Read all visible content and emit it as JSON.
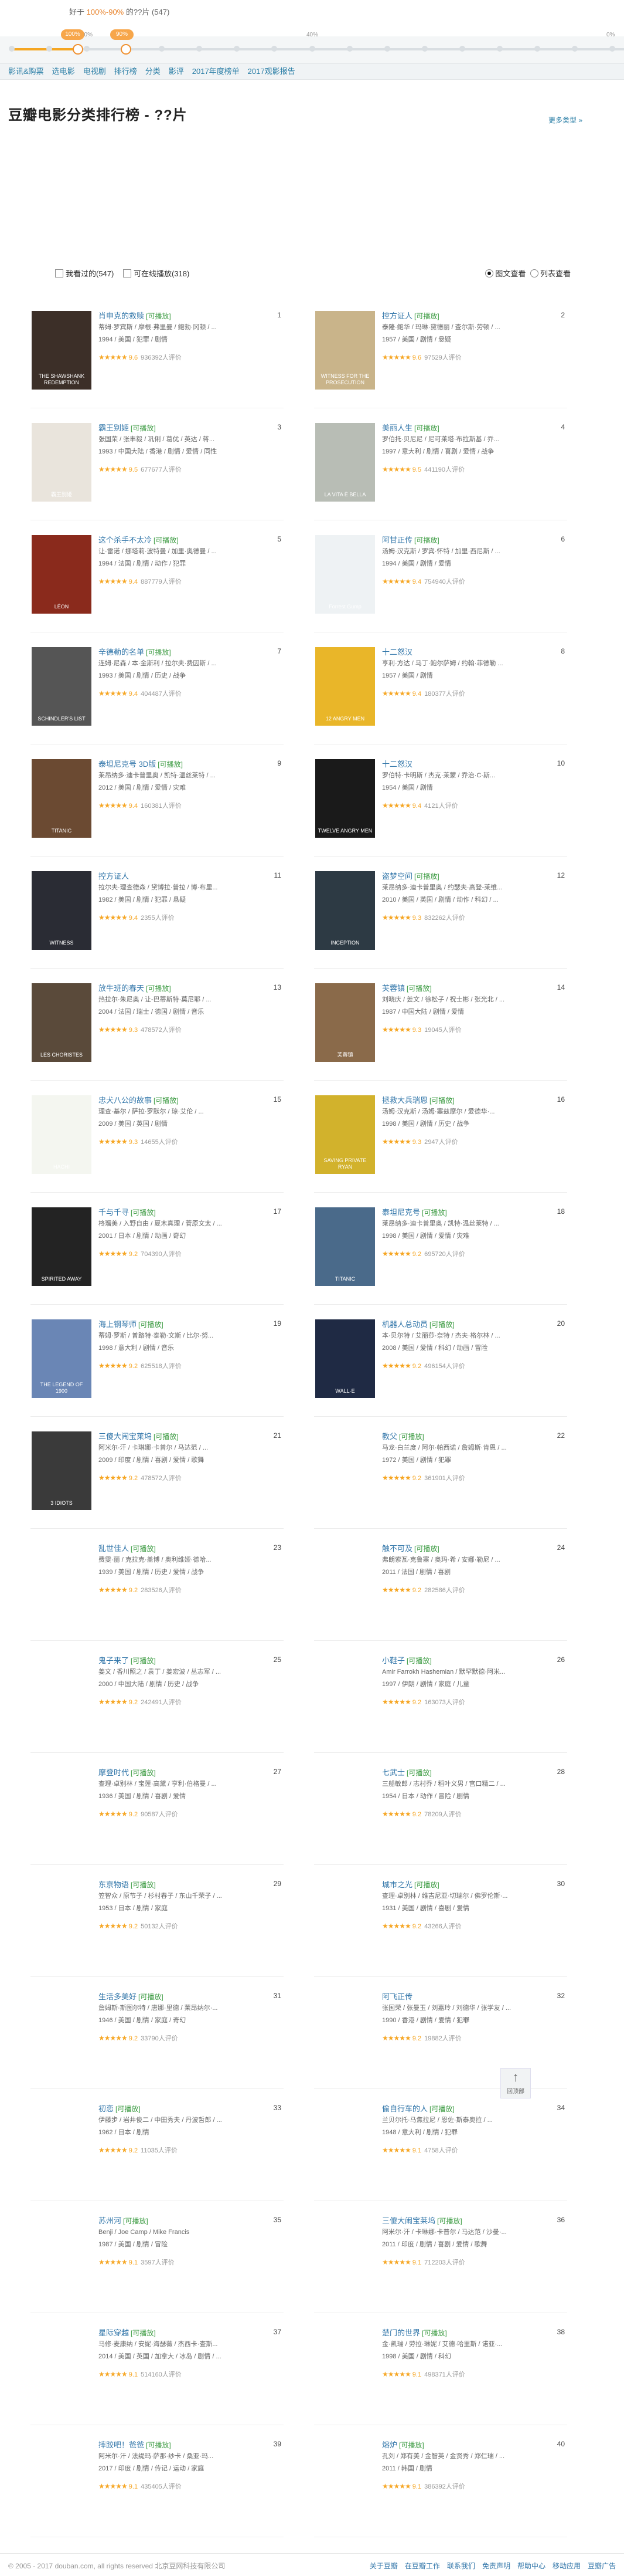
{
  "range": {
    "prefix": "好于",
    "value": "100%-90%",
    "suffix": "的??片 (547)",
    "handle_left": "100%",
    "handle_right": "90%",
    "ticks": [
      {
        "label": "",
        "pos": 0
      },
      {
        "label": "",
        "pos": 0
      },
      {
        "label": "80%",
        "pos": 0
      },
      {
        "label": "",
        "pos": 0
      },
      {
        "label": "",
        "pos": 0
      },
      {
        "label": "",
        "pos": 0
      },
      {
        "label": "",
        "pos": 0
      },
      {
        "label": "",
        "pos": 0
      },
      {
        "label": "40%",
        "pos": 0
      },
      {
        "label": "",
        "pos": 0
      },
      {
        "label": "",
        "pos": 0
      },
      {
        "label": "",
        "pos": 0
      },
      {
        "label": "",
        "pos": 0
      },
      {
        "label": "",
        "pos": 0
      },
      {
        "label": "",
        "pos": 0
      },
      {
        "label": "",
        "pos": 0
      },
      {
        "label": "0%",
        "pos": 0
      }
    ]
  },
  "nav": {
    "items": [
      "影讯&购票",
      "选电影",
      "电视剧",
      "排行榜",
      "分类",
      "影评",
      "2017年度榜单",
      "2017观影报告"
    ]
  },
  "page": {
    "title": "豆瓣电影分类排行榜 - ??片",
    "more": "更多类型 »"
  },
  "filters": {
    "seen": "我看过的(547)",
    "playable": "可在线播放(318)",
    "view_grid": "图文查看",
    "view_list": "列表查看"
  },
  "accent": "#f6a623",
  "movies": [
    {
      "rank": "1",
      "title": "肖申克的救赎",
      "tag": "[可播放]",
      "cast": "蒂姆·罗宾斯 / 摩根·弗里曼 / 鲍勃·冈顿 / ...",
      "meta": "1994 / 美国 / 犯罪 / 剧情",
      "stars": "★★★★★",
      "score": "9.6",
      "votes": "936392人评价",
      "poster": "#3c2f28",
      "ptext": "THE SHAWSHANK REDEMPTION"
    },
    {
      "rank": "2",
      "title": "控方证人",
      "tag": "[可播放]",
      "cast": "泰隆·鲍华 / 玛琳·黛德丽 / 查尔斯·劳顿 / ...",
      "meta": "1957 / 美国 / 剧情 / 悬疑",
      "stars": "★★★★★",
      "score": "9.6",
      "votes": "97529人评价",
      "poster": "#c9b48a",
      "ptext": "WITNESS FOR THE PROSECUTION"
    },
    {
      "rank": "3",
      "title": "霸王别姬",
      "tag": "[可播放]",
      "cast": "张国荣 / 张丰毅 / 巩俐 / 葛优 / 英达 / 蒋...",
      "meta": "1993 / 中国大陆 / 香港 / 剧情 / 爱情 / 同性",
      "stars": "★★★★★",
      "score": "9.5",
      "votes": "677677人评价",
      "poster": "#e9e4dc",
      "ptext": "霸王别姬"
    },
    {
      "rank": "4",
      "title": "美丽人生",
      "tag": "[可播放]",
      "cast": "罗伯托·贝尼尼 / 尼可莱塔·布拉斯基 / 乔...",
      "meta": "1997 / 意大利 / 剧情 / 喜剧 / 爱情 / 战争",
      "stars": "★★★★★",
      "score": "9.5",
      "votes": "441190人评价",
      "poster": "#b8bdb5",
      "ptext": "LA VITA È BELLA"
    },
    {
      "rank": "5",
      "title": "这个杀手不太冷",
      "tag": "[可播放]",
      "cast": "让·雷诺 / 娜塔莉·波特曼 / 加里·奥德曼 / ...",
      "meta": "1994 / 法国 / 剧情 / 动作 / 犯罪",
      "stars": "★★★★★",
      "score": "9.4",
      "votes": "887779人评价",
      "poster": "#8a2a1c",
      "ptext": "LÉON"
    },
    {
      "rank": "6",
      "title": "阿甘正传",
      "tag": "[可播放]",
      "cast": "汤姆·汉克斯 / 罗宾·怀特 / 加里·西尼斯 / ...",
      "meta": "1994 / 美国 / 剧情 / 爱情",
      "stars": "★★★★★",
      "score": "9.4",
      "votes": "754940人评价",
      "poster": "#eef2f4",
      "ptext": "Forrest Gump"
    },
    {
      "rank": "7",
      "title": "辛德勒的名单",
      "tag": "[可播放]",
      "cast": "连姆·尼森 / 本·金斯利 / 拉尔夫·费因斯 / ...",
      "meta": "1993 / 美国 / 剧情 / 历史 / 战争",
      "stars": "★★★★★",
      "score": "9.4",
      "votes": "404487人评价",
      "poster": "#555555",
      "ptext": "SCHINDLER'S LIST"
    },
    {
      "rank": "8",
      "title": "十二怒汉",
      "tag": "",
      "cast": "亨利·方达 / 马丁·鲍尔萨姆 / 约翰·菲德勒 ...",
      "meta": "1957 / 美国 / 剧情",
      "stars": "★★★★★",
      "score": "9.4",
      "votes": "180377人评价",
      "poster": "#e9b629",
      "ptext": "12 ANGRY MEN"
    },
    {
      "rank": "9",
      "title": "泰坦尼克号 3D版",
      "tag": "[可播放]",
      "cast": "莱昂纳多·迪卡普里奥 / 凯特·温丝莱特 / ...",
      "meta": "2012 / 美国 / 剧情 / 爱情 / 灾难",
      "stars": "★★★★★",
      "score": "9.4",
      "votes": "160381人评价",
      "poster": "#6b4a32",
      "ptext": "TITANIC"
    },
    {
      "rank": "10",
      "title": "十二怒汉",
      "tag": "",
      "cast": "罗伯特·卡明斯 / 杰克·莱蒙 / 乔治·C·斯...",
      "meta": "1954 / 美国 / 剧情",
      "stars": "★★★★★",
      "score": "9.4",
      "votes": "4121人评价",
      "poster": "#1a1a1a",
      "ptext": "TWELVE ANGRY MEN"
    },
    {
      "rank": "11",
      "title": "控方证人",
      "tag": "",
      "cast": "拉尔夫·理查德森 / 黛博拉·普拉 / 博·布里...",
      "meta": "1982 / 美国 / 剧情 / 犯罪 / 悬疑",
      "stars": "★★★★★",
      "score": "9.4",
      "votes": "2355人评价",
      "poster": "#2a2c34",
      "ptext": "WITNESS"
    },
    {
      "rank": "12",
      "title": "盗梦空间",
      "tag": "[可播放]",
      "cast": "莱昂纳多·迪卡普里奥 / 约瑟夫·高登-莱维...",
      "meta": "2010 / 美国 / 英国 / 剧情 / 动作 / 科幻 / ...",
      "stars": "★★★★★",
      "score": "9.3",
      "votes": "832262人评价",
      "poster": "#2d3a44",
      "ptext": "INCEPTION"
    },
    {
      "rank": "13",
      "title": "放牛班的春天",
      "tag": "[可播放]",
      "cast": "热拉尔·朱尼奥 / 让-巴蒂斯特·莫尼耶 / ...",
      "meta": "2004 / 法国 / 瑞士 / 德国 / 剧情 / 音乐",
      "stars": "★★★★★",
      "score": "9.3",
      "votes": "478572人评价",
      "poster": "#5a4a3a",
      "ptext": "LES CHORISTES"
    },
    {
      "rank": "14",
      "title": "芙蓉镇",
      "tag": "[可播放]",
      "cast": "刘晓庆 / 姜文 / 徐松子 / 祝士彬 / 张光北 / ...",
      "meta": "1987 / 中国大陆 / 剧情 / 爱情",
      "stars": "★★★★★",
      "score": "9.3",
      "votes": "19045人评价",
      "poster": "#8a6a4a",
      "ptext": "芙蓉镇"
    },
    {
      "rank": "15",
      "title": "忠犬八公的故事",
      "tag": "[可播放]",
      "cast": "理查·基尔 / 萨拉·罗默尔 / 琼·艾伦 / ...",
      "meta": "2009 / 美国 / 英国 / 剧情",
      "stars": "★★★★★",
      "score": "9.3",
      "votes": "14655人评价",
      "poster": "#f4f6f0",
      "ptext": "HACHI"
    },
    {
      "rank": "16",
      "title": "拯救大兵瑞恩",
      "tag": "[可播放]",
      "cast": "汤姆·汉克斯 / 汤姆·塞兹摩尔 / 爱德华·...",
      "meta": "1998 / 美国 / 剧情 / 历史 / 战争",
      "stars": "★★★★★",
      "score": "9.3",
      "votes": "2947人评价",
      "poster": "#d2b22c",
      "ptext": "SAVING PRIVATE RYAN"
    },
    {
      "rank": "17",
      "title": "千与千寻",
      "tag": "[可播放]",
      "cast": "柊瑠美 / 入野自由 / 夏木真理 / 菅原文太 / ...",
      "meta": "2001 / 日本 / 剧情 / 动画 / 奇幻",
      "stars": "★★★★★",
      "score": "9.2",
      "votes": "704390人评价",
      "poster": "#232323",
      "ptext": "SPIRITED AWAY"
    },
    {
      "rank": "18",
      "title": "泰坦尼克号",
      "tag": "[可播放]",
      "cast": "莱昂纳多·迪卡普里奥 / 凯特·温丝莱特 / ...",
      "meta": "1998 / 美国 / 剧情 / 爱情 / 灾难",
      "stars": "★★★★★",
      "score": "9.2",
      "votes": "695720人评价",
      "poster": "#4a6a8a",
      "ptext": "TITANIC"
    },
    {
      "rank": "19",
      "title": "海上钢琴师",
      "tag": "[可播放]",
      "cast": "蒂姆·罗斯 / 普路特·泰勒·文斯 / 比尔·努...",
      "meta": "1998 / 意大利 / 剧情 / 音乐",
      "stars": "★★★★★",
      "score": "9.2",
      "votes": "625518人评价",
      "poster": "#6a86b5",
      "ptext": "THE LEGEND OF 1900"
    },
    {
      "rank": "20",
      "title": "机器人总动员",
      "tag": "[可播放]",
      "cast": "本·贝尔特 / 艾丽莎·奈特 / 杰夫·格尔林 / ...",
      "meta": "2008 / 美国 / 爱情 / 科幻 / 动画 / 冒险",
      "stars": "★★★★★",
      "score": "9.2",
      "votes": "496154人评价",
      "poster": "#1f2a44",
      "ptext": "WALL·E"
    },
    {
      "rank": "21",
      "title": "三傻大闹宝莱坞",
      "tag": "[可播放]",
      "cast": "阿米尔·汗 / 卡琳娜·卡普尔 / 马达范 / ...",
      "meta": "2009 / 印度 / 剧情 / 喜剧 / 爱情 / 歌舞",
      "stars": "★★★★★",
      "score": "9.2",
      "votes": "478572人评价",
      "poster": "#3a3a3a",
      "ptext": "3 IDIOTS"
    },
    {
      "rank": "22",
      "title": "教父",
      "tag": "[可播放]",
      "cast": "马龙·白兰度 / 阿尔·帕西诺 / 詹姆斯·肯恩 / ...",
      "meta": "1972 / 美国 / 剧情 / 犯罪",
      "stars": "★★★★★",
      "score": "9.2",
      "votes": "361901人评价",
      "poster": "#ffffff",
      "ptext": ""
    },
    {
      "rank": "23",
      "title": "乱世佳人",
      "tag": "[可播放]",
      "cast": "费雯·丽 / 克拉克·盖博 / 奥利维娅·德哈...",
      "meta": "1939 / 美国 / 剧情 / 历史 / 爱情 / 战争",
      "stars": "★★★★★",
      "score": "9.2",
      "votes": "283526人评价",
      "poster": "#ffffff",
      "ptext": ""
    },
    {
      "rank": "24",
      "title": "触不可及",
      "tag": "[可播放]",
      "cast": "弗朗索瓦·克鲁塞 / 奥玛·希 / 安娜·勒尼 / ...",
      "meta": "2011 / 法国 / 剧情 / 喜剧",
      "stars": "★★★★★",
      "score": "9.2",
      "votes": "282586人评价",
      "poster": "#ffffff",
      "ptext": ""
    },
    {
      "rank": "25",
      "title": "鬼子来了",
      "tag": "[可播放]",
      "cast": "姜文 / 香川照之 / 袁丁 / 姜宏波 / 丛志军 / ...",
      "meta": "2000 / 中国大陆 / 剧情 / 历史 / 战争",
      "stars": "★★★★★",
      "score": "9.2",
      "votes": "242491人评价",
      "poster": "#ffffff",
      "ptext": ""
    },
    {
      "rank": "26",
      "title": "小鞋子",
      "tag": "[可播放]",
      "cast": "Amir Farrokh Hashemian / 默罕默德·阿米...",
      "meta": "1997 / 伊朗 / 剧情 / 家庭 / 儿童",
      "stars": "★★★★★",
      "score": "9.2",
      "votes": "163073人评价",
      "poster": "#ffffff",
      "ptext": ""
    },
    {
      "rank": "27",
      "title": "摩登时代",
      "tag": "[可播放]",
      "cast": "查理·卓别林 / 宝莲·高黛 / 亨利·伯格曼 / ...",
      "meta": "1936 / 美国 / 剧情 / 喜剧 / 爱情",
      "stars": "★★★★★",
      "score": "9.2",
      "votes": "90587人评价",
      "poster": "#ffffff",
      "ptext": ""
    },
    {
      "rank": "28",
      "title": "七武士",
      "tag": "[可播放]",
      "cast": "三船敏郎 / 志村乔 / 稻叶义男 / 宫口精二 / ...",
      "meta": "1954 / 日本 / 动作 / 冒险 / 剧情",
      "stars": "★★★★★",
      "score": "9.2",
      "votes": "78209人评价",
      "poster": "#ffffff",
      "ptext": ""
    },
    {
      "rank": "29",
      "title": "东京物语",
      "tag": "[可播放]",
      "cast": "笠智众 / 原节子 / 杉村春子 / 东山千荣子 / ...",
      "meta": "1953 / 日本 / 剧情 / 家庭",
      "stars": "★★★★★",
      "score": "9.2",
      "votes": "50132人评价",
      "poster": "#ffffff",
      "ptext": ""
    },
    {
      "rank": "30",
      "title": "城市之光",
      "tag": "[可播放]",
      "cast": "查理·卓别林 / 维吉尼亚·切瑞尔 / 佛罗伦斯·...",
      "meta": "1931 / 美国 / 剧情 / 喜剧 / 爱情",
      "stars": "★★★★★",
      "score": "9.2",
      "votes": "43266人评价",
      "poster": "#ffffff",
      "ptext": ""
    },
    {
      "rank": "31",
      "title": "生活多美好",
      "tag": "[可播放]",
      "cast": "詹姆斯·斯图尔特 / 唐娜·里德 / 莱昂纳尔·...",
      "meta": "1946 / 美国 / 剧情 / 家庭 / 奇幻",
      "stars": "★★★★★",
      "score": "9.2",
      "votes": "33790人评价",
      "poster": "#ffffff",
      "ptext": ""
    },
    {
      "rank": "32",
      "title": "阿飞正传",
      "tag": "",
      "cast": "张国荣 / 张曼玉 / 刘嘉玲 / 刘德华 / 张学友 / ...",
      "meta": "1990 / 香港 / 剧情 / 爱情 / 犯罪",
      "stars": "★★★★★",
      "score": "9.2",
      "votes": "19882人评价",
      "poster": "#ffffff",
      "ptext": ""
    },
    {
      "rank": "33",
      "title": "初恋",
      "tag": "[可播放]",
      "cast": "伊藤步 / 岩井俊二 / 中田秀夫 / 丹波哲郎 / ...",
      "meta": "1962 / 日本 / 剧情",
      "stars": "★★★★★",
      "score": "9.2",
      "votes": "11035人评价",
      "poster": "#ffffff",
      "ptext": ""
    },
    {
      "rank": "34",
      "title": "偷自行车的人",
      "tag": "[可播放]",
      "cast": "兰贝尔托·马焦拉尼 / 恩佐·斯泰奥拉 / ...",
      "meta": "1948 / 意大利 / 剧情 / 犯罪",
      "stars": "★★★★★",
      "score": "9.1",
      "votes": "4758人评价",
      "poster": "#ffffff",
      "ptext": ""
    },
    {
      "rank": "35",
      "title": "苏州河",
      "tag": "[可播放]",
      "cast": "Benji / Joe Camp / Mike Francis",
      "meta": "1987 / 美国 / 剧情 / 冒险",
      "stars": "★★★★★",
      "score": "9.1",
      "votes": "3597人评价",
      "poster": "#ffffff",
      "ptext": ""
    },
    {
      "rank": "36",
      "title": "三傻大闹宝莱坞",
      "tag": "[可播放]",
      "cast": "阿米尔·汗 / 卡琳娜·卡普尔 / 马达范 / 沙曼·...",
      "meta": "2011 / 印度 / 剧情 / 喜剧 / 爱情 / 歌舞",
      "stars": "★★★★★",
      "score": "9.1",
      "votes": "712203人评价",
      "poster": "#ffffff",
      "ptext": ""
    },
    {
      "rank": "37",
      "title": "星际穿越",
      "tag": "[可播放]",
      "cast": "马修·麦康纳 / 安妮·海瑟薇 / 杰西卡·查斯...",
      "meta": "2014 / 美国 / 英国 / 加拿大 / 冰岛 / 剧情 / ...",
      "stars": "★★★★★",
      "score": "9.1",
      "votes": "514160人评价",
      "poster": "#ffffff",
      "ptext": ""
    },
    {
      "rank": "38",
      "title": "楚门的世界",
      "tag": "[可播放]",
      "cast": "金·凯瑞 / 劳拉·琳妮 / 艾德·哈里斯 / 诺亚·...",
      "meta": "1998 / 美国 / 剧情 / 科幻",
      "stars": "★★★★★",
      "score": "9.1",
      "votes": "498371人评价",
      "poster": "#ffffff",
      "ptext": ""
    },
    {
      "rank": "39",
      "title": "摔跤吧！爸爸",
      "tag": "[可播放]",
      "cast": "阿米尔·汗 / 法缇玛·萨那·纱卡 / 桑亚·玛...",
      "meta": "2017 / 印度 / 剧情 / 传记 / 运动 / 家庭",
      "stars": "★★★★★",
      "score": "9.1",
      "votes": "435405人评价",
      "poster": "#ffffff",
      "ptext": ""
    },
    {
      "rank": "40",
      "title": "熔炉",
      "tag": "[可播放]",
      "cast": "孔刘 / 郑有美 / 金智英 / 金贤秀 / 郑仁瑞 / ...",
      "meta": "2011 / 韩国 / 剧情",
      "stars": "★★★★★",
      "score": "9.1",
      "votes": "386392人评价",
      "poster": "#ffffff",
      "ptext": ""
    }
  ],
  "back_top": "回顶部",
  "footer": {
    "copyright": "© 2005 - 2017 douban.com, all rights reserved 北京豆网科技有限公司",
    "links": [
      "关于豆瓣",
      "在豆瓣工作",
      "联系我们",
      "免责声明",
      "帮助中心",
      "移动应用",
      "豆瓣广告"
    ]
  }
}
